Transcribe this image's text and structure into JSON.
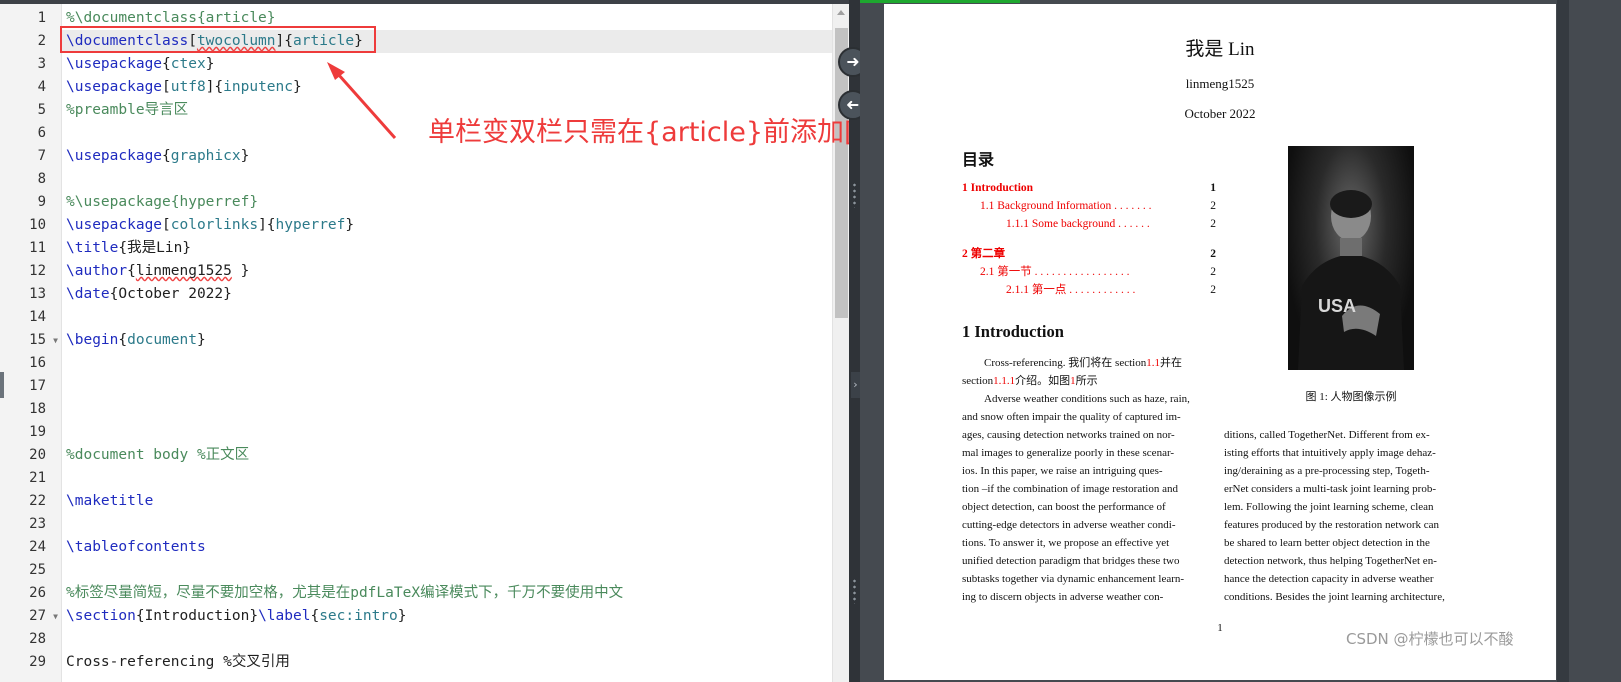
{
  "editor": {
    "line_numbers": [
      "1",
      "2",
      "3",
      "4",
      "5",
      "6",
      "7",
      "8",
      "9",
      "10",
      "11",
      "12",
      "13",
      "14",
      "15",
      "16",
      "17",
      "18",
      "19",
      "20",
      "21",
      "22",
      "23",
      "24",
      "25",
      "26",
      "27",
      "28",
      "29"
    ],
    "lines": [
      [
        {
          "t": "%\\documentclass{article}",
          "c": "com"
        }
      ],
      [
        {
          "t": "\\documentclass",
          "c": "cmd"
        },
        {
          "t": "[",
          "c": "txt"
        },
        {
          "t": "twocolumn",
          "c": "arg",
          "sq": true
        },
        {
          "t": "]{",
          "c": "txt"
        },
        {
          "t": "article",
          "c": "arg"
        },
        {
          "t": "}",
          "c": "txt"
        }
      ],
      [
        {
          "t": "\\usepackage",
          "c": "cmd"
        },
        {
          "t": "{",
          "c": "txt"
        },
        {
          "t": "ctex",
          "c": "arg"
        },
        {
          "t": "}",
          "c": "txt"
        }
      ],
      [
        {
          "t": "\\usepackage",
          "c": "cmd"
        },
        {
          "t": "[",
          "c": "txt"
        },
        {
          "t": "utf8",
          "c": "arg"
        },
        {
          "t": "]{",
          "c": "txt"
        },
        {
          "t": "inputenc",
          "c": "arg"
        },
        {
          "t": "}",
          "c": "txt"
        }
      ],
      [
        {
          "t": "%preamble导言区",
          "c": "com"
        }
      ],
      [],
      [
        {
          "t": "\\usepackage",
          "c": "cmd"
        },
        {
          "t": "{",
          "c": "txt"
        },
        {
          "t": "graphicx",
          "c": "arg"
        },
        {
          "t": "}",
          "c": "txt"
        }
      ],
      [],
      [
        {
          "t": "%\\usepackage{hyperref}",
          "c": "com"
        }
      ],
      [
        {
          "t": "\\usepackage",
          "c": "cmd"
        },
        {
          "t": "[",
          "c": "txt"
        },
        {
          "t": "colorlinks",
          "c": "arg"
        },
        {
          "t": "]{",
          "c": "txt"
        },
        {
          "t": "hyperref",
          "c": "arg"
        },
        {
          "t": "}",
          "c": "txt"
        }
      ],
      [
        {
          "t": "\\title",
          "c": "cmd"
        },
        {
          "t": "{我是Lin}",
          "c": "txt"
        }
      ],
      [
        {
          "t": "\\author",
          "c": "cmd"
        },
        {
          "t": "{",
          "c": "txt"
        },
        {
          "t": "linmeng1525",
          "c": "txt",
          "sq": true
        },
        {
          "t": " }",
          "c": "txt"
        }
      ],
      [
        {
          "t": "\\date",
          "c": "cmd"
        },
        {
          "t": "{October 2022}",
          "c": "txt"
        }
      ],
      [],
      [
        {
          "t": "\\begin",
          "c": "cmd"
        },
        {
          "t": "{",
          "c": "txt"
        },
        {
          "t": "document",
          "c": "arg"
        },
        {
          "t": "}",
          "c": "txt"
        }
      ],
      [],
      [],
      [],
      [],
      [
        {
          "t": "%document body %正文区",
          "c": "com"
        }
      ],
      [],
      [
        {
          "t": "\\maketitle",
          "c": "cmd"
        }
      ],
      [],
      [
        {
          "t": "\\tableofcontents",
          "c": "cmd"
        }
      ],
      [],
      [
        {
          "t": "%标签尽量简短，尽量不要加空格，尤其是在pdfLaTeX编译模式下，千万不要使用中文",
          "c": "com"
        }
      ],
      [
        {
          "t": "\\section",
          "c": "cmd"
        },
        {
          "t": "{Introduction}",
          "c": "txt"
        },
        {
          "t": "\\label",
          "c": "cmd"
        },
        {
          "t": "{",
          "c": "txt"
        },
        {
          "t": "sec:intro",
          "c": "arg"
        },
        {
          "t": "}",
          "c": "txt"
        }
      ],
      [],
      [
        {
          "t": "Cross-referencing %交叉引用",
          "c": "txt"
        }
      ]
    ],
    "active_line": 2,
    "fold_lines": [
      15,
      27
    ]
  },
  "annotation": {
    "callout_text": "单栏变双栏只需在{article}前添加[twocolumn]参数即可",
    "color": "#ee3b3b"
  },
  "pdf": {
    "title": "我是 Lin",
    "author": "linmeng1525",
    "date": "October 2022",
    "toc_heading": "目录",
    "toc": [
      {
        "label": "1   Introduction",
        "page": "1",
        "level": 1
      },
      {
        "label": "1.1   Background Information . . . . . . .",
        "page": "2",
        "level": 2
      },
      {
        "label": "1.1.1   Some background . . . . . .",
        "page": "2",
        "level": 3
      },
      {
        "label": "2   第二章",
        "page": "2",
        "level": 1
      },
      {
        "label": "2.1   第一节 . . . . . . . . . . . . . . . . .",
        "page": "2",
        "level": 2
      },
      {
        "label": "2.1.1   第一点 . . . . . . . . . . . .",
        "page": "2",
        "level": 3
      }
    ],
    "section_heading": "1   Introduction",
    "crossref_line1_a": "Cross-referencing. 我们将在 section",
    "crossref_ref1": "1.1",
    "crossref_line1_b": "并在",
    "crossref_line2_a": "section",
    "crossref_ref2": "1.1.1",
    "crossref_line2_b": "介绍。如图",
    "crossref_ref3": "1",
    "crossref_line2_c": "所示",
    "col1_lines": [
      "Adverse weather conditions such as haze, rain,",
      "and snow often impair the quality of captured im-",
      "ages, causing detection networks trained on nor-",
      "mal images to generalize poorly in these scenar-",
      "ios.  In this paper, we raise an intriguing ques-",
      "tion –if the combination of image restoration and",
      "object detection, can boost the performance of",
      "cutting-edge detectors in adverse weather condi-",
      "tions.  To answer it, we propose an effective yet",
      "unified detection paradigm that bridges these two",
      "subtasks together via dynamic enhancement learn-",
      "ing to discern objects in adverse weather con-"
    ],
    "col2_lines": [
      "ditions, called TogetherNet.  Different from ex-",
      "isting efforts that intuitively apply image dehaz-",
      "ing/deraining as a pre-processing step, Togeth-",
      "erNet considers a multi-task joint learning prob-",
      "lem.  Following the joint learning scheme, clean",
      "features produced by the restoration network can",
      "be shared to learn better object detection in the",
      "detection network, thus helping TogetherNet en-",
      "hance the detection capacity in adverse weather",
      "conditions. Besides the joint learning architecture,"
    ],
    "figure_caption": "图 1: 人物图像示例",
    "figure_jersey_text": "USA",
    "page_number": "1"
  },
  "watermark": "CSDN @柠檬也可以不酸"
}
